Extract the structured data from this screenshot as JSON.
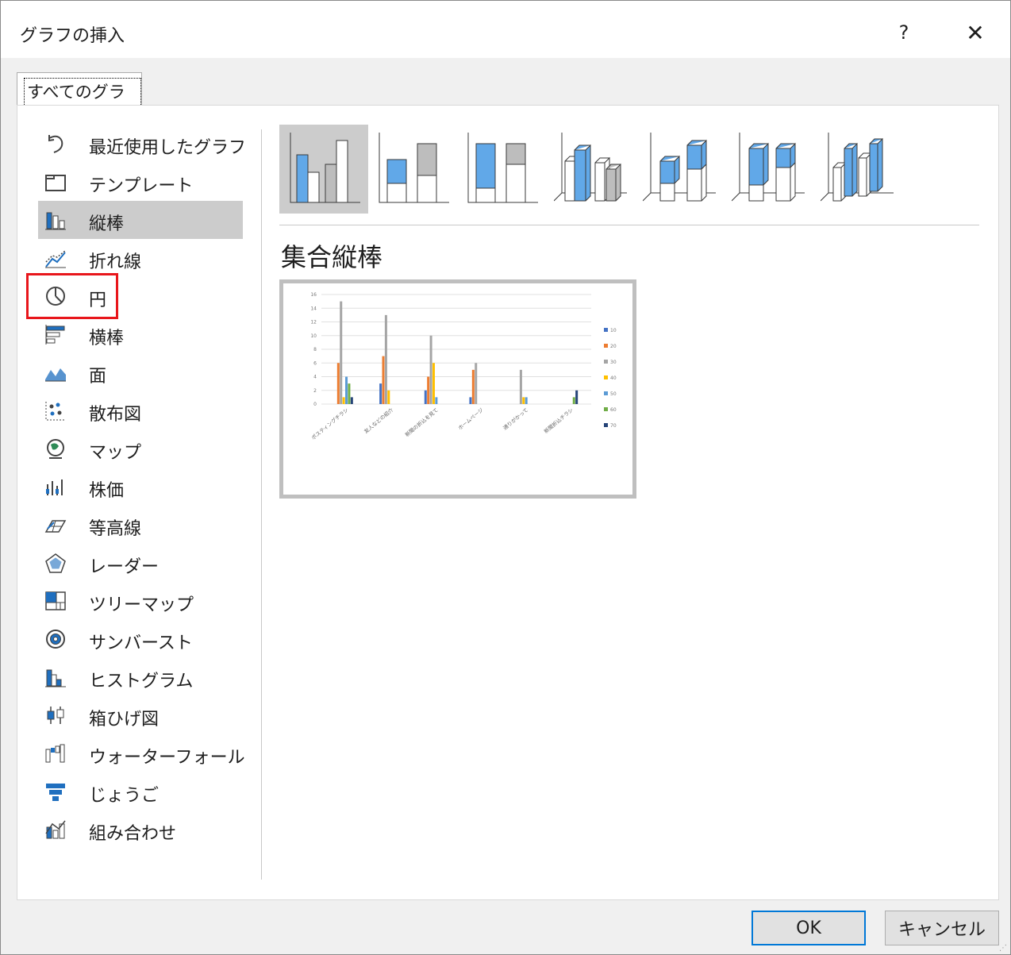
{
  "dialog": {
    "title": "グラフの挿入",
    "help": "?",
    "close": "✕"
  },
  "tabs": [
    {
      "label": "すべてのグラフ"
    }
  ],
  "categories": [
    {
      "label": "最近使用したグラフ",
      "icon": "recent-icon"
    },
    {
      "label": "テンプレート",
      "icon": "folder-icon"
    },
    {
      "label": "縦棒",
      "icon": "column-chart-icon",
      "selected": true
    },
    {
      "label": "折れ線",
      "icon": "line-chart-icon"
    },
    {
      "label": "円",
      "icon": "pie-chart-icon"
    },
    {
      "label": "横棒",
      "icon": "bar-chart-icon"
    },
    {
      "label": "面",
      "icon": "area-chart-icon"
    },
    {
      "label": "散布図",
      "icon": "scatter-chart-icon"
    },
    {
      "label": "マップ",
      "icon": "map-chart-icon"
    },
    {
      "label": "株価",
      "icon": "stock-chart-icon"
    },
    {
      "label": "等高線",
      "icon": "surface-chart-icon"
    },
    {
      "label": "レーダー",
      "icon": "radar-chart-icon"
    },
    {
      "label": "ツリーマップ",
      "icon": "treemap-chart-icon"
    },
    {
      "label": "サンバースト",
      "icon": "sunburst-chart-icon"
    },
    {
      "label": "ヒストグラム",
      "icon": "histogram-chart-icon"
    },
    {
      "label": "箱ひげ図",
      "icon": "box-whisker-chart-icon"
    },
    {
      "label": "ウォーターフォール",
      "icon": "waterfall-chart-icon"
    },
    {
      "label": "じょうご",
      "icon": "funnel-chart-icon"
    },
    {
      "label": "組み合わせ",
      "icon": "combo-chart-icon"
    }
  ],
  "variants": [
    {
      "icon": "clustered-column-icon",
      "selected": true
    },
    {
      "icon": "stacked-column-icon"
    },
    {
      "icon": "100-stacked-column-icon"
    },
    {
      "icon": "3d-clustered-column-icon"
    },
    {
      "icon": "3d-stacked-column-icon"
    },
    {
      "icon": "3d-100-stacked-column-icon"
    },
    {
      "icon": "3d-column-icon"
    }
  ],
  "preview": {
    "name": "集合縦棒"
  },
  "chart_data": {
    "type": "bar",
    "title": "",
    "ylim": [
      0,
      16
    ],
    "yticks": [
      "0",
      "2",
      "4",
      "6",
      "8",
      "10",
      "12",
      "14",
      "16"
    ],
    "categories": [
      "ポスティングチラシ",
      "友人などの紹介",
      "新聞の折込を見て",
      "ホームページ",
      "通りがかって",
      "新聞折込チラシ"
    ],
    "series": [
      {
        "name": "10",
        "color": "#4472c4",
        "values": [
          0,
          3,
          2,
          1,
          0,
          0
        ]
      },
      {
        "name": "20",
        "color": "#ed7d31",
        "values": [
          6,
          7,
          4,
          5,
          0,
          0
        ]
      },
      {
        "name": "30",
        "color": "#a5a5a5",
        "values": [
          15,
          13,
          10,
          6,
          5,
          0
        ]
      },
      {
        "name": "40",
        "color": "#ffc000",
        "values": [
          1,
          2,
          6,
          0,
          1,
          0
        ]
      },
      {
        "name": "50",
        "color": "#5b9bd5",
        "values": [
          4,
          0,
          1,
          0,
          1,
          0
        ]
      },
      {
        "name": "60",
        "color": "#70ad47",
        "values": [
          3,
          0,
          0,
          0,
          0,
          1
        ]
      },
      {
        "name": "70",
        "color": "#264478",
        "values": [
          1,
          0,
          0,
          0,
          0,
          2
        ]
      }
    ],
    "legend": "right",
    "grid": true
  },
  "buttons": {
    "ok": "OK",
    "cancel": "キャンセル"
  }
}
